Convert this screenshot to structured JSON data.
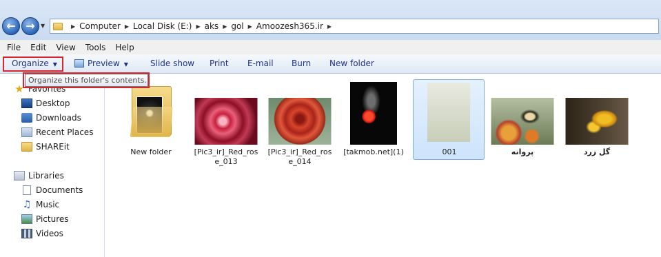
{
  "address": {
    "crumbs": [
      "Computer",
      "Local Disk (E:)",
      "aks",
      "gol",
      "Amoozesh365.ir"
    ]
  },
  "menubar": {
    "items": [
      "File",
      "Edit",
      "View",
      "Tools",
      "Help"
    ]
  },
  "toolbar": {
    "organize": "Organize",
    "preview": "Preview",
    "slideshow": "Slide show",
    "print": "Print",
    "email": "E-mail",
    "burn": "Burn",
    "new_folder": "New folder"
  },
  "tooltip": {
    "text": "Organize this folder's contents."
  },
  "navpane": {
    "favorites_label": "Favorites",
    "favorites": [
      "Desktop",
      "Downloads",
      "Recent Places",
      "SHAREit"
    ],
    "libraries_label": "Libraries",
    "libraries": [
      "Documents",
      "Music",
      "Pictures",
      "Videos"
    ]
  },
  "files": [
    {
      "line1": "New folder",
      "line2": ""
    },
    {
      "line1": "[Pic3_ir]_Red_ros",
      "line2": "e_013"
    },
    {
      "line1": "[Pic3_ir]_Red_ros",
      "line2": "e_014"
    },
    {
      "line1": "[takmob.net](1)",
      "line2": ""
    },
    {
      "line1": "001",
      "line2": ""
    },
    {
      "line1": "پروانه",
      "line2": ""
    },
    {
      "line1": "گل زرد",
      "line2": ""
    }
  ],
  "colors": {
    "highlight_border": "#d9232e",
    "command_text": "#1e3287",
    "selection_bg": "#cde4fb"
  }
}
